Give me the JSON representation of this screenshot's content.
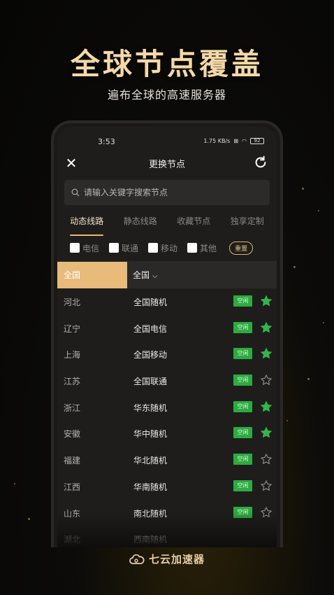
{
  "promo": {
    "headline": "全球节点覆盖",
    "subline": "遍布全球的高速服务器",
    "brand": "七云加速器"
  },
  "status_bar": {
    "time": "3:53",
    "net_speed": "1.75 KB/s",
    "battery": "92"
  },
  "header": {
    "title": "更换节点",
    "close_icon": "close-icon",
    "refresh_icon": "refresh-icon"
  },
  "search": {
    "placeholder": "请输入关键字搜索节点"
  },
  "tabs": [
    {
      "label": "动态线路",
      "active": true
    },
    {
      "label": "静态线路",
      "active": false
    },
    {
      "label": "收藏节点",
      "active": false
    },
    {
      "label": "独享定制",
      "active": false
    }
  ],
  "filters": {
    "options": [
      "电信",
      "联通",
      "移动",
      "其他"
    ],
    "reset_label": "重置"
  },
  "columns": {
    "province_selected": "全国",
    "isp_dropdown": "全国"
  },
  "nodes": [
    {
      "province": "河北",
      "name": "全国随机",
      "status": "空闲",
      "favorite": true
    },
    {
      "province": "辽宁",
      "name": "全国电信",
      "status": "空闲",
      "favorite": true
    },
    {
      "province": "上海",
      "name": "全国移动",
      "status": "空闲",
      "favorite": true
    },
    {
      "province": "江苏",
      "name": "全国联通",
      "status": "空闲",
      "favorite": false
    },
    {
      "province": "浙江",
      "name": "华东随机",
      "status": "空闲",
      "favorite": true
    },
    {
      "province": "安徽",
      "name": "华中随机",
      "status": "空闲",
      "favorite": true
    },
    {
      "province": "福建",
      "name": "华北随机",
      "status": "空闲",
      "favorite": false
    },
    {
      "province": "江西",
      "name": "华南随机",
      "status": "空闲",
      "favorite": false
    },
    {
      "province": "山东",
      "name": "南北随机",
      "status": "空闲",
      "favorite": false
    },
    {
      "province": "湖北",
      "name": "西南随机",
      "status": "",
      "favorite": false
    }
  ],
  "colors": {
    "accent": "#e8bb7a",
    "badge": "#2cab3f",
    "star_on": "#33b548"
  }
}
